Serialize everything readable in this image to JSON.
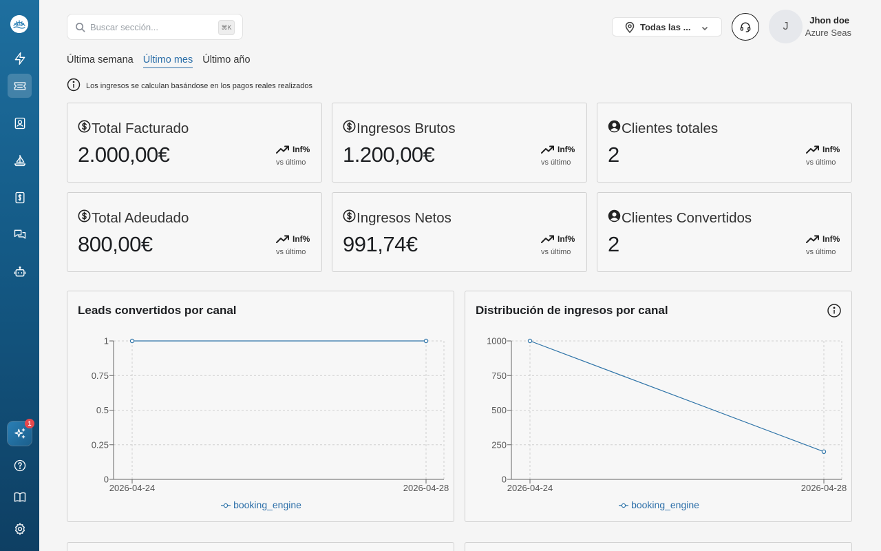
{
  "sidebar": {
    "notification_count": "1",
    "items": [
      {
        "icon": "lightning-icon"
      },
      {
        "icon": "ticket-icon"
      },
      {
        "icon": "contact-icon"
      },
      {
        "icon": "sailboat-icon"
      },
      {
        "icon": "invoice-icon"
      },
      {
        "icon": "chat-icon"
      },
      {
        "icon": "robot-icon"
      }
    ],
    "bottom": [
      {
        "icon": "help-icon"
      },
      {
        "icon": "book-icon"
      },
      {
        "icon": "settings-icon"
      }
    ]
  },
  "search": {
    "placeholder": "Buscar sección...",
    "shortcut": "⌘K"
  },
  "location": {
    "selected": "Todas las ..."
  },
  "user": {
    "initial": "J",
    "name": "Jhon doe",
    "org": "Azure Seas"
  },
  "periods": {
    "week": "Última semana",
    "month": "Último mes",
    "year": "Último año",
    "active": "month"
  },
  "info_note": "Los ingresos se calculan basándose en los pagos reales realizados",
  "kpis": [
    {
      "title": "Total Facturado",
      "value": "2.000,00€",
      "trend": "Inf%",
      "sub": "vs último",
      "icon": "dollar-icon"
    },
    {
      "title": "Ingresos Brutos",
      "value": "1.200,00€",
      "trend": "Inf%",
      "sub": "vs último",
      "icon": "dollar-icon"
    },
    {
      "title": "Clientes totales",
      "value": "2",
      "trend": "Inf%",
      "sub": "vs último",
      "icon": "user-circle-icon"
    },
    {
      "title": "Total Adeudado",
      "value": "800,00€",
      "trend": "Inf%",
      "sub": "vs último",
      "icon": "dollar-icon"
    },
    {
      "title": "Ingresos Netos",
      "value": "991,74€",
      "trend": "Inf%",
      "sub": "vs último",
      "icon": "dollar-icon"
    },
    {
      "title": "Clientes Convertidos",
      "value": "2",
      "trend": "Inf%",
      "sub": "vs último",
      "icon": "user-circle-icon"
    }
  ],
  "colors": {
    "accent": "#2b6ea8",
    "line": "#2f74a8",
    "sidebar_top": "#1e6f9f",
    "sidebar_bottom": "#0e3f63",
    "badge": "#e5484d"
  },
  "chart_data": [
    {
      "type": "line",
      "title": "Leads convertidos por canal",
      "x": [
        "2026-04-24",
        "2026-04-28"
      ],
      "series": [
        {
          "name": "booking_engine",
          "values": [
            1,
            1
          ]
        }
      ],
      "yticks": [
        "0",
        "0.25",
        "0.5",
        "0.75",
        "1"
      ],
      "ylim": [
        0,
        1
      ],
      "grid": true,
      "legend": "bottom"
    },
    {
      "type": "line",
      "title": "Distribución de ingresos por canal",
      "x": [
        "2026-04-24",
        "2026-04-28"
      ],
      "series": [
        {
          "name": "booking_engine",
          "values": [
            1000,
            200
          ]
        }
      ],
      "yticks": [
        "0",
        "250",
        "500",
        "750",
        "1000"
      ],
      "ylim": [
        0,
        1000
      ],
      "grid": true,
      "legend": "bottom"
    }
  ]
}
